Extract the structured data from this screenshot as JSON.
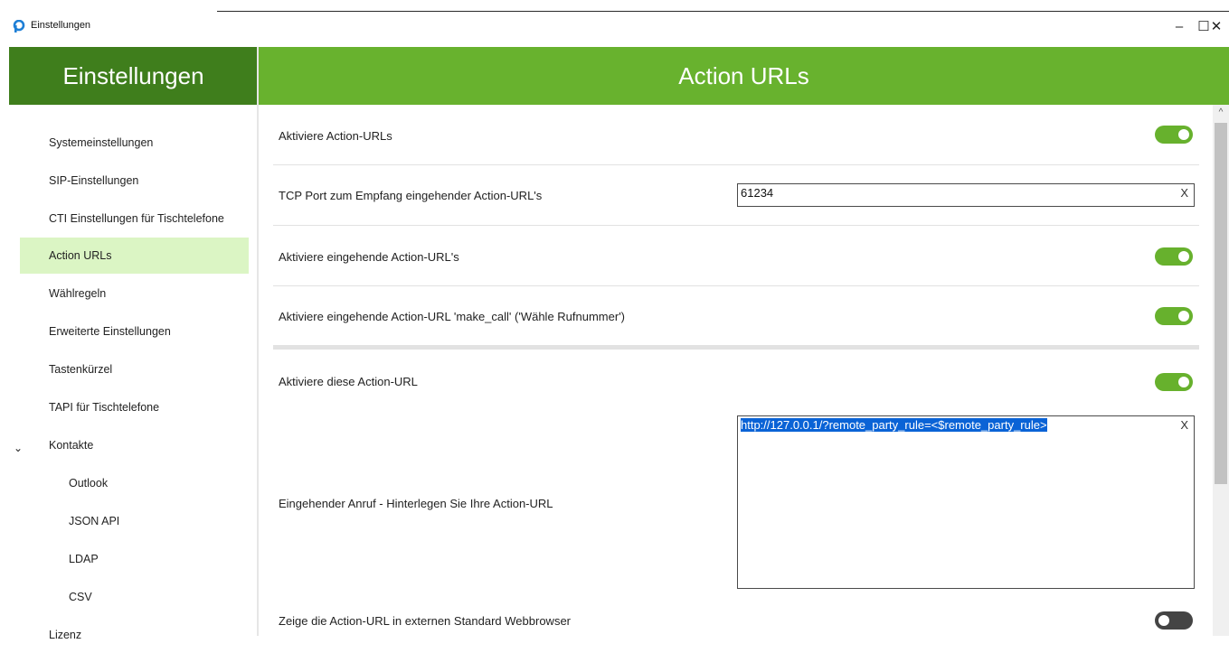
{
  "window": {
    "title": "Einstellungen",
    "minimize": "–",
    "maximize": "☐",
    "close": "✕"
  },
  "sidebar": {
    "header": "Einstellungen",
    "items": [
      {
        "label": "Systemeinstellungen"
      },
      {
        "label": "SIP-Einstellungen"
      },
      {
        "label": "CTI Einstellungen für Tischtelefone"
      },
      {
        "label": "Action URLs"
      },
      {
        "label": "Wählregeln"
      },
      {
        "label": "Erweiterte Einstellungen"
      },
      {
        "label": "Tastenkürzel"
      },
      {
        "label": "TAPI für Tischtelefone"
      },
      {
        "label": "Kontakte"
      },
      {
        "label": "Outlook"
      },
      {
        "label": "JSON API"
      },
      {
        "label": "LDAP"
      },
      {
        "label": "CSV"
      },
      {
        "label": "Lizenz"
      }
    ],
    "chevron": "⌄"
  },
  "main": {
    "header": "Action URLs",
    "rows": {
      "enable_action_urls": {
        "label": "Aktiviere Action-URLs",
        "checked": true
      },
      "tcp_port": {
        "label": "TCP Port zum Empfang eingehender Action-URL's",
        "value": "61234",
        "clear": "X"
      },
      "enable_incoming": {
        "label": "Aktiviere eingehende Action-URL's",
        "checked": true
      },
      "enable_make_call": {
        "label": "Aktiviere eingehende Action-URL 'make_call' ('Wähle Rufnummer')",
        "checked": true
      },
      "enable_this": {
        "label": "Aktiviere diese Action-URL",
        "checked": true
      },
      "incoming_call": {
        "label": "Eingehender Anruf - Hinterlegen Sie Ihre Action-URL",
        "value": "http://127.0.0.1/?remote_party_rule=<$remote_party_rule>",
        "clear": "X"
      },
      "show_in_browser": {
        "label": "Zeige die Action-URL in externen Standard Webbrowser",
        "checked": false
      }
    }
  },
  "scrollbar": {
    "up_arrow": "^"
  }
}
